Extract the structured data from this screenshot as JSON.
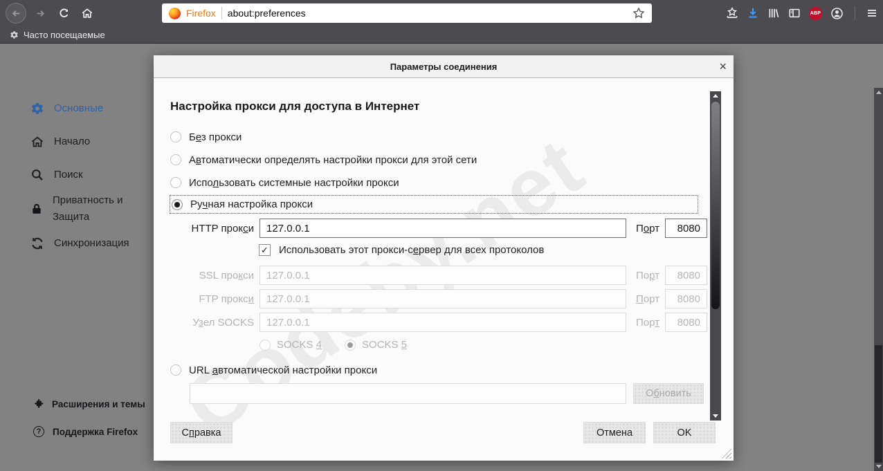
{
  "browser": {
    "brand_label": "Firefox",
    "address": "about:preferences",
    "abp_badge": "ABP",
    "bookmarks_bar_label": "Часто посещаемые"
  },
  "sidebar": {
    "items": [
      {
        "label": "Основные"
      },
      {
        "label": "Начало"
      },
      {
        "label": "Поиск"
      },
      {
        "label_line1": "Приватность и",
        "label_line2": "Защита"
      },
      {
        "label": "Синхронизация"
      }
    ],
    "footer": [
      {
        "label": "Расширения и темы"
      },
      {
        "label": "Поддержка Firefox"
      }
    ]
  },
  "dialog": {
    "title": "Параметры соединения",
    "close_label": "×",
    "heading": "Настройка прокси для доступа в Интернет",
    "radio_no_proxy": {
      "pre": "Б",
      "key": "е",
      "post": "з прокси"
    },
    "radio_auto_detect": {
      "pre": "А",
      "key": "в",
      "post": "томатически определять настройки прокси для этой сети"
    },
    "radio_system": {
      "pre": "Испо",
      "key": "л",
      "post": "ьзовать системные настройки прокси"
    },
    "radio_manual": {
      "pre": "Ру",
      "key": "ч",
      "post": "ная настройка прокси"
    },
    "http": {
      "label_pre": "HTTP прок",
      "label_key": "с",
      "label_post": "и",
      "value": "127.0.0.1",
      "port_pre": "П",
      "port_key": "о",
      "port_post": "рт",
      "port_value": "8080"
    },
    "share_checkbox": {
      "check": "✓",
      "pre": "Использовать этот прокси-с",
      "key": "е",
      "post": "рвер для всех протоколов"
    },
    "ssl": {
      "label_pre": "SSL про",
      "label_key": "к",
      "label_post": "си",
      "value": "127.0.0.1",
      "port_pre": "По",
      "port_key": "р",
      "port_post": "т",
      "port_value": "8080"
    },
    "ftp": {
      "label_pre": "FTP прокс",
      "label_key": "и",
      "label_post": "",
      "value": "127.0.0.1",
      "port_pre": "",
      "port_key": "П",
      "port_post": "орт",
      "port_value": "8080"
    },
    "socks": {
      "label_pre": "У",
      "label_key": "з",
      "label_post": "ел SOCKS",
      "value": "127.0.0.1",
      "port_pre": "Пор",
      "port_key": "т",
      "port_post": "",
      "port_value": "8080"
    },
    "socks4": {
      "pre": "SOCKS ",
      "key": "4",
      "post": ""
    },
    "socks5": {
      "pre": "SOCKS ",
      "key": "5",
      "post": ""
    },
    "radio_pac": {
      "pre": "URL ",
      "key": "а",
      "post": "втоматической настройки прокси"
    },
    "pac_value": "",
    "reload_button": {
      "pre": "О",
      "key": "б",
      "post": "новить"
    },
    "help_button": {
      "pre": "С",
      "key": "п",
      "post": "равка"
    },
    "cancel_label": "Отмена",
    "ok_label": "OK"
  },
  "watermark": "Codeby.net"
}
